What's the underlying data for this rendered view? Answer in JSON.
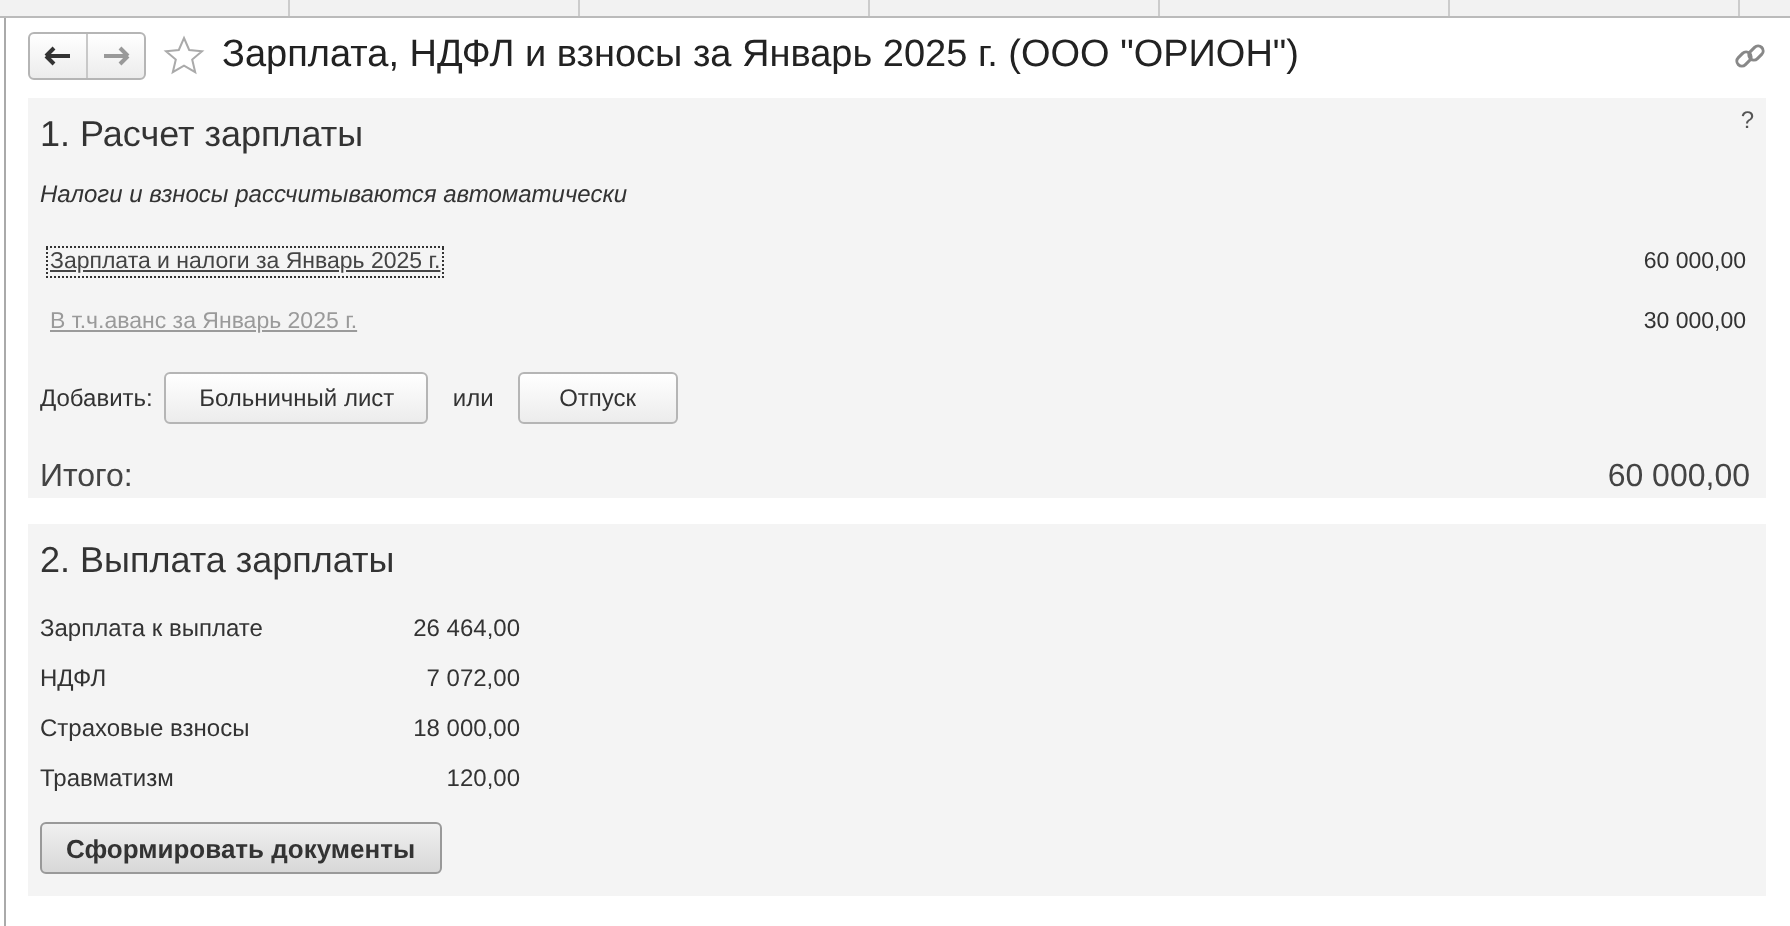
{
  "window": {
    "title": "Зарплата, НДФЛ и взносы за Январь 2025 г. (ООО \"ОРИОН\")"
  },
  "section1": {
    "heading": "1. Расчет зарплаты",
    "help": "?",
    "note": "Налоги и взносы рассчитываются автоматически",
    "links": [
      {
        "label": "Зарплата и налоги за Январь 2025 г.",
        "amount": "60 000,00",
        "focused": true,
        "disabled": false
      },
      {
        "label": "В т.ч.аванс за Январь 2025 г.",
        "amount": "30 000,00",
        "focused": false,
        "disabled": true
      }
    ],
    "add_label": "Добавить:",
    "add_buttons": [
      "Больничный лист",
      "Отпуск"
    ],
    "separator": "или",
    "total_label": "Итого:",
    "total": "60 000,00"
  },
  "section2": {
    "heading": "2. Выплата зарплаты",
    "rows": [
      {
        "label": "Зарплата к выплате",
        "amount": "26 464,00"
      },
      {
        "label": "НДФЛ",
        "amount": "7 072,00"
      },
      {
        "label": "Страховые взносы",
        "amount": "18 000,00"
      },
      {
        "label": "Травматизм",
        "amount": "120,00"
      }
    ],
    "button": "Сформировать документы"
  }
}
